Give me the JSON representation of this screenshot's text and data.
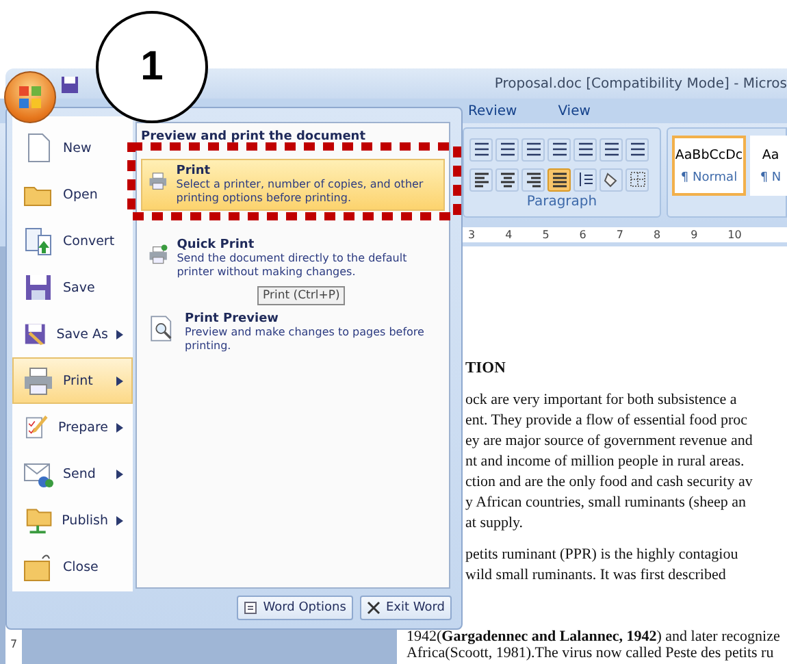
{
  "callout": "1",
  "window": {
    "title": "Proposal.doc [Compatibility Mode] - Micros"
  },
  "tabs": [
    {
      "label": "Review",
      "selected": false
    },
    {
      "label": "View",
      "selected": false
    }
  ],
  "paragraph_group": {
    "label": "Paragraph",
    "align_buttons": [
      {
        "kind": "left",
        "selected": false
      },
      {
        "kind": "center",
        "selected": false
      },
      {
        "kind": "right",
        "selected": false
      },
      {
        "kind": "justify",
        "selected": true
      }
    ]
  },
  "styles": [
    {
      "preview": "AaBbCcDc",
      "name": "¶ Normal",
      "selected": true
    },
    {
      "preview": "Aa",
      "name": "¶ N",
      "selected": false
    }
  ],
  "ruler": [
    "3",
    "4",
    "5",
    "6",
    "7",
    "8",
    "9",
    "10"
  ],
  "vertical_ruler": "7",
  "office_menu": {
    "items": [
      {
        "label": "New",
        "kind": "new",
        "submenu": false,
        "selected": false
      },
      {
        "label": "Open",
        "kind": "open",
        "submenu": false,
        "selected": false
      },
      {
        "label": "Convert",
        "kind": "convert",
        "submenu": false,
        "selected": false
      },
      {
        "label": "Save",
        "kind": "save",
        "submenu": false,
        "selected": false
      },
      {
        "label": "Save As",
        "kind": "saveas",
        "submenu": true,
        "selected": false
      },
      {
        "label": "Print",
        "kind": "print",
        "submenu": true,
        "selected": true
      },
      {
        "label": "Prepare",
        "kind": "prepare",
        "submenu": true,
        "selected": false
      },
      {
        "label": "Send",
        "kind": "send",
        "submenu": true,
        "selected": false
      },
      {
        "label": "Publish",
        "kind": "publish",
        "submenu": true,
        "selected": false
      },
      {
        "label": "Close",
        "kind": "close",
        "submenu": false,
        "selected": false
      }
    ],
    "panel_heading": "Preview and print the document",
    "panel_items": [
      {
        "title": "Print",
        "description": "Select a printer, number of copies, and other printing options before printing.",
        "kind": "print",
        "selected": true
      },
      {
        "title": "Quick Print",
        "description": "Send the document directly to the default printer without making changes.",
        "kind": "quickprint",
        "selected": false
      },
      {
        "title": "Print Preview",
        "description": "Preview and make changes to pages before printing.",
        "kind": "preview",
        "selected": false
      }
    ],
    "tooltip": "Print (Ctrl+P)",
    "buttons": [
      {
        "label": "Word Options",
        "kind": "options"
      },
      {
        "label": "Exit Word",
        "kind": "exit"
      }
    ]
  },
  "document": {
    "heading": "TION",
    "lines": [
      "ock are very important for both subsistence a",
      "ent. They provide a flow of essential food proc",
      "ey are major source of government revenue and",
      "nt and income of million people in rural areas.",
      "ction and are the only food and cash security av",
      "y African countries, small ruminants (sheep an",
      "at supply."
    ],
    "lines_2": [
      "petits ruminant (PPR) is the highly contagiou",
      "wild small ruminants. It was first described"
    ],
    "lines_3": [
      "1942(**Gargadennec and Lalannec, 1942**) and later recognize",
      "Africa(Scoott, 1981).The virus now called Peste des petits ru"
    ]
  }
}
